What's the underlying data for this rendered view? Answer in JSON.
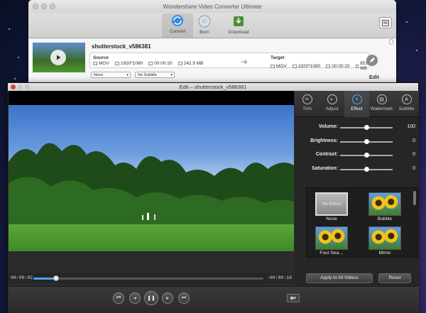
{
  "main_window": {
    "title": "Wondershare Video Converter Ultimate",
    "toolbar": [
      {
        "label": "Convert",
        "icon": "convert-icon",
        "active": true
      },
      {
        "label": "Burn",
        "icon": "burn-icon",
        "active": false
      },
      {
        "label": "Download",
        "icon": "download-icon",
        "active": false
      }
    ],
    "file": {
      "name": "shutterstock_v586381",
      "source_label": "Source",
      "target_label": "Target",
      "source": {
        "format": "MOV",
        "resolution": "1920*1080",
        "duration": "00:00:20",
        "size": "242.9 MB"
      },
      "target": {
        "format": "MOV",
        "resolution": "1920*1080",
        "duration": "00:00:20",
        "size": "851.1 MB"
      },
      "audio_select": "None",
      "subtitle_select": "No Subtitle",
      "edit_label": "Edit"
    }
  },
  "edit_window": {
    "title": "Edit – shutterstock_v586381",
    "tabs": [
      {
        "label": "Trim",
        "icon": "scissors-icon",
        "glyph": "✂",
        "active": false
      },
      {
        "label": "Adjust",
        "icon": "adjust-icon",
        "glyph": "◐",
        "active": false
      },
      {
        "label": "Effect",
        "icon": "effect-wand-icon",
        "glyph": "✦",
        "active": true
      },
      {
        "label": "Watermark",
        "icon": "watermark-icon",
        "glyph": "▤",
        "active": false
      },
      {
        "label": "Subtitle",
        "icon": "subtitle-icon",
        "glyph": "A",
        "active": false
      }
    ],
    "sliders": [
      {
        "label": "Volume:",
        "value": "100",
        "level": 0.5
      },
      {
        "label": "Brightness:",
        "value": "0",
        "level": 0.5
      },
      {
        "label": "Contrast:",
        "value": "0",
        "level": 0.5
      },
      {
        "label": "Saturation:",
        "value": "0",
        "level": 0.5
      }
    ],
    "effects": [
      {
        "label": "None",
        "thumb_text": "No Effect",
        "selected": true
      },
      {
        "label": "Bubble",
        "thumb_text": "",
        "selected": false
      },
      {
        "label": "Four Sea…",
        "thumb_text": "",
        "selected": false
      },
      {
        "label": "Mirror",
        "thumb_text": "",
        "selected": false
      }
    ],
    "apply_all_label": "Apply to All Videos",
    "reset_label": "Reset",
    "timeline": {
      "current": "00:00:02",
      "remaining": "-00:00:18",
      "progress": 0.1
    }
  },
  "colors": {
    "accent": "#4aa3ff",
    "panel_bg": "#262626",
    "window_bg": "#ececec"
  }
}
